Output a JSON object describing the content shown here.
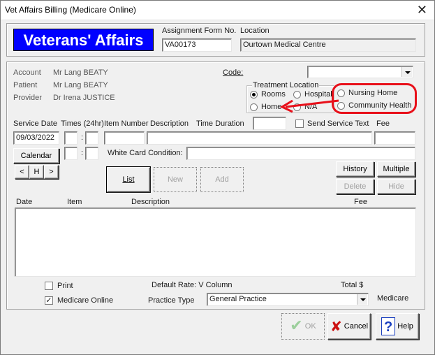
{
  "window": {
    "title": "Vet Affairs Billing (Medicare Online)",
    "close_glyph": "✕"
  },
  "header": {
    "banner": "Veterans' Affairs",
    "assignment_label": "Assignment Form No.",
    "assignment_value": "VA00173",
    "location_label": "Location",
    "location_value": "Ourtown Medical Centre"
  },
  "patient_info": {
    "account_label": "Account",
    "account_value": "Mr Lang BEATY",
    "patient_label": "Patient",
    "patient_value": "Mr Lang BEATY",
    "provider_label": "Provider",
    "provider_value": "Dr Irena JUSTICE"
  },
  "code": {
    "label": "Code:",
    "value": ""
  },
  "treatment_location": {
    "title": "Treatment Location",
    "options": [
      "Rooms",
      "Hospital",
      "Home",
      "N/A",
      "Nursing Home",
      "Community Health"
    ],
    "selected": "Rooms"
  },
  "service": {
    "date_label": "Service Date",
    "date_value": "09/03/2022",
    "times_label": "Times (24hr)",
    "colon": ":",
    "item_label": "Item Number",
    "desc_label": "Description",
    "duration_label": "Time Duration",
    "send_text_label": "Send Service Text",
    "fee_label": "Fee",
    "white_card_label": "White Card Condition:"
  },
  "buttons": {
    "calendar": "Calendar",
    "prev": "<",
    "home": "H",
    "next": ">",
    "list": "List",
    "new": "New",
    "add": "Add",
    "history": "History",
    "multiple": "Multiple",
    "delete": "Delete",
    "hide": "Hide",
    "ok": "OK",
    "cancel": "Cancel",
    "help": "Help"
  },
  "grid": {
    "columns": [
      "Date",
      "Item",
      "Description",
      "Fee"
    ],
    "rows": []
  },
  "footer": {
    "print_label": "Print",
    "print_checked": false,
    "medicare_online_label": "Medicare Online",
    "medicare_online_checked": true,
    "default_rate": "Default Rate: V Column",
    "total_label": "Total $",
    "practice_type_label": "Practice Type",
    "practice_type_value": "General Practice",
    "medicare_label": "Medicare"
  },
  "colors": {
    "banner": "#0000ff",
    "annotation": "#e8101a"
  }
}
